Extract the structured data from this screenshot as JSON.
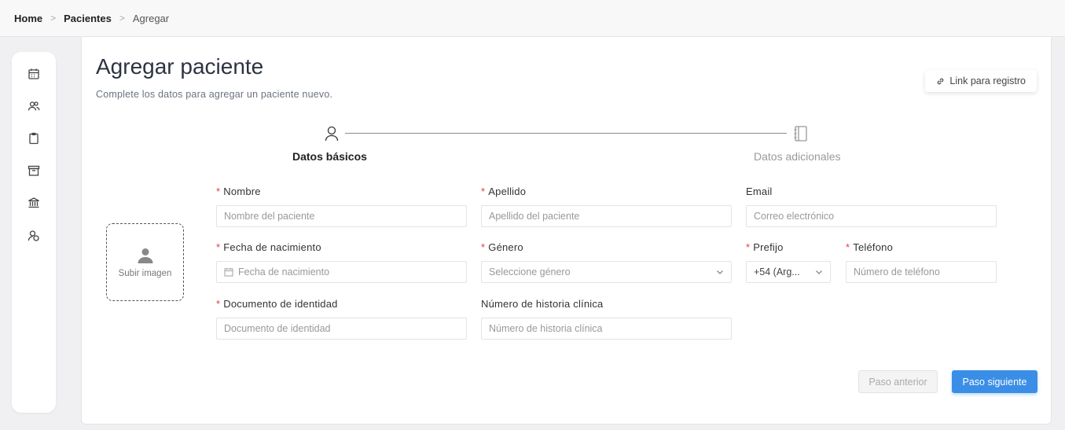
{
  "breadcrumb": {
    "home": "Home",
    "section": "Pacientes",
    "current": "Agregar",
    "separator": ">"
  },
  "sidebar": {
    "items": [
      {
        "icon": "calendar-icon"
      },
      {
        "icon": "users-icon"
      },
      {
        "icon": "clipboard-icon"
      },
      {
        "icon": "archive-icon"
      },
      {
        "icon": "bank-icon"
      },
      {
        "icon": "user-circle-icon"
      }
    ]
  },
  "header": {
    "title": "Agregar paciente",
    "subtitle": "Complete los datos para agregar un paciente nuevo.",
    "link_button": "Link para registro"
  },
  "stepper": {
    "steps": [
      {
        "label": "Datos básicos",
        "icon": "user-icon",
        "active": true
      },
      {
        "label": "Datos adicionales",
        "icon": "notebook-icon",
        "active": false
      }
    ]
  },
  "upload": {
    "label": "Subir imagen"
  },
  "form": {
    "nombre": {
      "label": "Nombre",
      "required": "*",
      "placeholder": "Nombre del paciente"
    },
    "apellido": {
      "label": "Apellido",
      "required": "*",
      "placeholder": "Apellido del paciente"
    },
    "email": {
      "label": "Email",
      "placeholder": "Correo electrónico"
    },
    "fecha": {
      "label": "Fecha de nacimiento",
      "required": "*",
      "placeholder": "Fecha de nacimiento"
    },
    "genero": {
      "label": "Género",
      "required": "*",
      "placeholder": "Seleccione género"
    },
    "prefijo": {
      "label": "Prefijo",
      "required": "*",
      "value": "+54 (Arg..."
    },
    "telefono": {
      "label": "Teléfono",
      "required": "*",
      "placeholder": "Número de teléfono"
    },
    "documento": {
      "label": "Documento de identidad",
      "required": "*",
      "placeholder": "Documento de identidad"
    },
    "historia": {
      "label": "Número de historia clínica",
      "placeholder": "Número de historia clínica"
    }
  },
  "footer": {
    "prev_label": "Paso anterior",
    "next_label": "Paso siguiente"
  },
  "colors": {
    "primary": "#3a8ee6",
    "required": "#e0403c",
    "background": "#f0f0f2"
  }
}
